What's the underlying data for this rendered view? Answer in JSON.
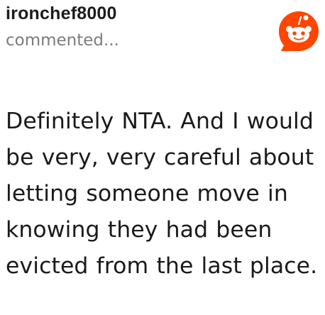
{
  "comment": {
    "username": "ironchef8000",
    "action_text": "commented...",
    "text": "Definitely NTA. And I would be very, very careful about letting someone move in knowing they had been evicted from the last place."
  },
  "icons": {
    "logo": "reddit-logo-icon"
  },
  "colors": {
    "brand": "#ff4500",
    "username": "#1c1c1c",
    "muted": "#7c7c7c",
    "text": "#1a1a1a"
  }
}
